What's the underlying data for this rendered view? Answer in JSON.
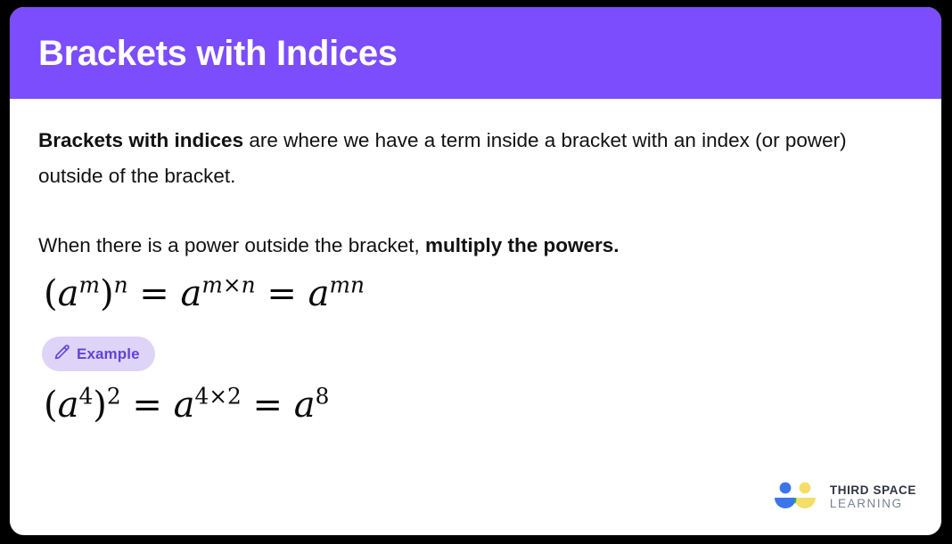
{
  "card": {
    "header": {
      "title": "Brackets with Indices",
      "background_color": "#7b4dfc",
      "title_color": "#ffffff"
    },
    "body": {
      "paragraph_1": {
        "bold_lead": "Brackets with indices",
        "rest": " are where we have a term inside a bracket with an index (or power) outside of the bracket."
      },
      "paragraph_2": {
        "normal": "When there is a power outside the bracket, ",
        "bold_tail": "multiply the powers."
      },
      "formula_general": {
        "latex": "(a^m)^n = a^{m \\times n} = a^{mn}",
        "base": "a",
        "inner_exponent": "m",
        "outer_exponent": "n",
        "product_exponent": "m×n",
        "result_exponent": "mn",
        "times_symbol": "×",
        "equals_symbol": "="
      },
      "example_badge": {
        "label": "Example",
        "icon": "pencil-icon",
        "background_color": "#ddd4f7",
        "text_color": "#6243d6"
      },
      "formula_example": {
        "latex": "(a^4)^2 = a^{4 \\times 2} = a^8",
        "base": "a",
        "inner_exponent": "4",
        "outer_exponent": "2",
        "product_exponent": "4×2",
        "result_exponent": "8",
        "times_symbol": "×",
        "equals_symbol": "="
      }
    },
    "logo": {
      "line_1": "THIRD SPACE",
      "line_2": "LEARNING",
      "mark_colors": {
        "blue": "#3b76e8",
        "yellow": "#f5de67",
        "green": "#2aa86a"
      }
    }
  }
}
